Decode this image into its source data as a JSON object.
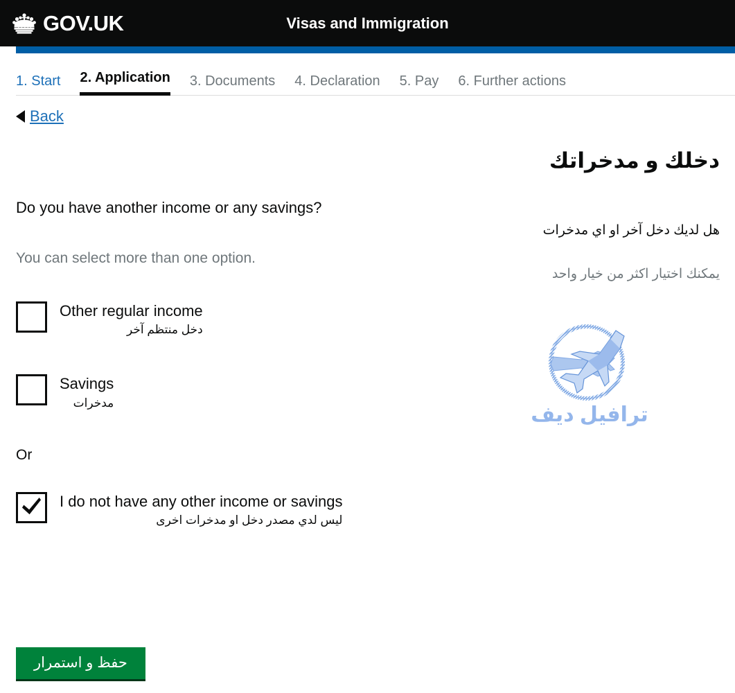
{
  "header": {
    "brand_name": "GOV.UK",
    "crown_icon": "crown-icon",
    "service_title": "Visas and Immigration"
  },
  "step_nav": {
    "steps": [
      {
        "label": "1. Start",
        "state": "link"
      },
      {
        "label": "2. Application",
        "state": "current"
      },
      {
        "label": "3. Documents",
        "state": "disabled"
      },
      {
        "label": "4. Declaration",
        "state": "disabled"
      },
      {
        "label": "5. Pay",
        "state": "disabled"
      },
      {
        "label": "6. Further actions",
        "state": "disabled"
      }
    ]
  },
  "back": {
    "label": "Back",
    "arrow_icon": "triangle-left-icon"
  },
  "arabic_panel": {
    "heading": "دخلك و مدخراتك",
    "question": "هل لديك دخل آخر او اي مدخرات",
    "hint": "يمكنك اختيار اكثر من خيار واحد"
  },
  "watermark": {
    "icon": "airplanes-in-circle-icon",
    "text": "ترافيل ديف",
    "color": "#8fb3ea"
  },
  "form": {
    "question_en": "Do you have another income or any savings?",
    "hint_en": "You can select more than one option.",
    "or_label": "Or",
    "options": [
      {
        "label_en": "Other regular income",
        "label_ar": "دخل منتظم آخر",
        "checked": false
      },
      {
        "label_en": "Savings",
        "label_ar": "مدخرات",
        "checked": false
      }
    ],
    "exclusive_option": {
      "label_en": "I do not have any other income or savings",
      "label_ar": "ليس لدي مصدر دخل او مدخرات اخرى",
      "checked": true
    },
    "submit": {
      "label": "حفظ و استمرار",
      "color": "#00823b"
    }
  },
  "colors": {
    "header_black": "#0b0c0c",
    "accent_blue": "#005ea5",
    "link_blue": "#1d70b8",
    "muted_grey": "#6f777b",
    "button_green": "#00823b"
  }
}
